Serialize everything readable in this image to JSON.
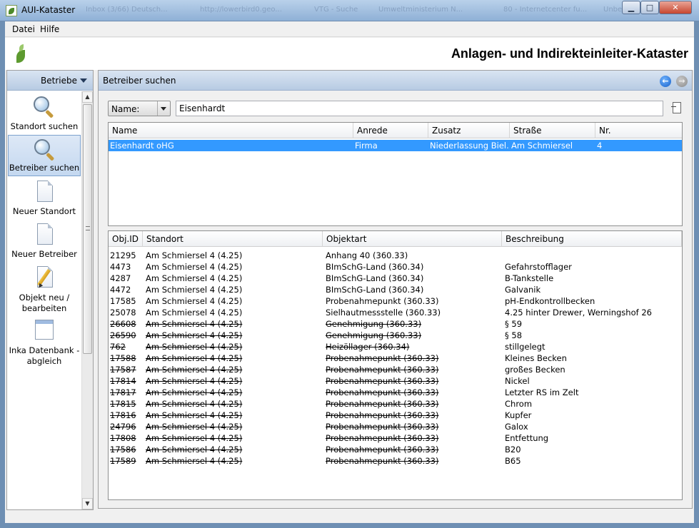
{
  "window": {
    "title": "AUI-Kataster",
    "background_tabs": [
      "Inbox (3/66) Deutsch...",
      "http://lowerbird0.geo...",
      "VTG - Suche",
      "Umweltministerium N...",
      "80 - Internetcenter fu...",
      "Unbe..."
    ],
    "buttons": {
      "minimize": "▁",
      "maximize": "□",
      "close": "✕"
    }
  },
  "menu": [
    "Datei",
    "Hilfe"
  ],
  "header": {
    "title": "Anlagen- und Indirekteinleiter-Kataster"
  },
  "sidebar": {
    "category": "Betriebe",
    "items": [
      {
        "label": "Standort suchen",
        "icon": "magnifier-icon",
        "selected": false
      },
      {
        "label": "Betreiber suchen",
        "icon": "magnifier-icon",
        "selected": true
      },
      {
        "label": "Neuer Standort",
        "icon": "document-icon",
        "selected": false
      },
      {
        "label": "Neuer Betreiber",
        "icon": "document-icon",
        "selected": false
      },
      {
        "label": "Objekt neu / bearbeiten",
        "icon": "pencil-document-icon",
        "selected": false
      },
      {
        "label": "Inka Datenbank - abgleich",
        "icon": "window-document-icon",
        "selected": false
      }
    ]
  },
  "panel": {
    "title": "Betreiber suchen",
    "search": {
      "field": "Name:",
      "value": "Eisenhardt"
    }
  },
  "operators_table": {
    "columns": [
      "Name",
      "Anrede",
      "Zusatz",
      "Straße",
      "Nr."
    ],
    "rows": [
      [
        "Eisenhardt oHG",
        "Firma",
        "Niederlassung Biel...",
        "Am Schmiersel",
        "4"
      ]
    ]
  },
  "objects_table": {
    "columns": [
      "Obj.ID",
      "Standort",
      "Objektart",
      "Beschreibung"
    ],
    "rows": [
      {
        "id": "21295",
        "standort": "Am Schmiersel 4 (4.25)",
        "objektart": "Anhang 40 (360.33)",
        "beschreibung": "",
        "struck": false
      },
      {
        "id": "4473",
        "standort": "Am Schmiersel 4 (4.25)",
        "objektart": "BImSchG-Land (360.34)",
        "beschreibung": "Gefahrstofflager",
        "struck": false
      },
      {
        "id": "4287",
        "standort": "Am Schmiersel 4 (4.25)",
        "objektart": "BImSchG-Land (360.34)",
        "beschreibung": "B-Tankstelle",
        "struck": false
      },
      {
        "id": "4472",
        "standort": "Am Schmiersel 4 (4.25)",
        "objektart": "BImSchG-Land (360.34)",
        "beschreibung": "Galvanik",
        "struck": false
      },
      {
        "id": "17585",
        "standort": "Am Schmiersel 4 (4.25)",
        "objektart": "Probenahmepunkt (360.33)",
        "beschreibung": "pH-Endkontrollbecken",
        "struck": false
      },
      {
        "id": "25078",
        "standort": "Am Schmiersel 4 (4.25)",
        "objektart": "Sielhautmessstelle (360.33)",
        "beschreibung": "4.25 hinter Drewer, Werningshof 26",
        "struck": false
      },
      {
        "id": "26608",
        "standort": "Am Schmiersel 4 (4.25)",
        "objektart": "Genehmigung (360.33)",
        "beschreibung": "§ 59",
        "struck": true
      },
      {
        "id": "26590",
        "standort": "Am Schmiersel 4 (4.25)",
        "objektart": "Genehmigung (360.33)",
        "beschreibung": "§ 58",
        "struck": true
      },
      {
        "id": "762",
        "standort": "Am Schmiersel 4 (4.25)",
        "objektart": "Heizöllager (360.34)",
        "beschreibung": "stillgelegt",
        "struck": true
      },
      {
        "id": "17588",
        "standort": "Am Schmiersel 4 (4.25)",
        "objektart": "Probenahmepunkt (360.33)",
        "beschreibung": "Kleines Becken",
        "struck": true
      },
      {
        "id": "17587",
        "standort": "Am Schmiersel 4 (4.25)",
        "objektart": "Probenahmepunkt (360.33)",
        "beschreibung": "großes Becken",
        "struck": true
      },
      {
        "id": "17814",
        "standort": "Am Schmiersel 4 (4.25)",
        "objektart": "Probenahmepunkt (360.33)",
        "beschreibung": "Nickel",
        "struck": true
      },
      {
        "id": "17817",
        "standort": "Am Schmiersel 4 (4.25)",
        "objektart": "Probenahmepunkt (360.33)",
        "beschreibung": "Letzter RS im Zelt",
        "struck": true
      },
      {
        "id": "17815",
        "standort": "Am Schmiersel 4 (4.25)",
        "objektart": "Probenahmepunkt (360.33)",
        "beschreibung": "Chrom",
        "struck": true
      },
      {
        "id": "17816",
        "standort": "Am Schmiersel 4 (4.25)",
        "objektart": "Probenahmepunkt (360.33)",
        "beschreibung": "Kupfer",
        "struck": true
      },
      {
        "id": "24796",
        "standort": "Am Schmiersel 4 (4.25)",
        "objektart": "Probenahmepunkt (360.33)",
        "beschreibung": "Galox",
        "struck": true
      },
      {
        "id": "17808",
        "standort": "Am Schmiersel 4 (4.25)",
        "objektart": "Probenahmepunkt (360.33)",
        "beschreibung": "Entfettung",
        "struck": true
      },
      {
        "id": "17586",
        "standort": "Am Schmiersel 4 (4.25)",
        "objektart": "Probenahmepunkt (360.33)",
        "beschreibung": "B20",
        "struck": true
      },
      {
        "id": "17589",
        "standort": "Am Schmiersel 4 (4.25)",
        "objektart": "Probenahmepunkt (360.33)",
        "beschreibung": "B65",
        "struck": true
      }
    ]
  },
  "colors": {
    "selection": "#3399ff",
    "header_gradient": "#b7cbe3"
  }
}
